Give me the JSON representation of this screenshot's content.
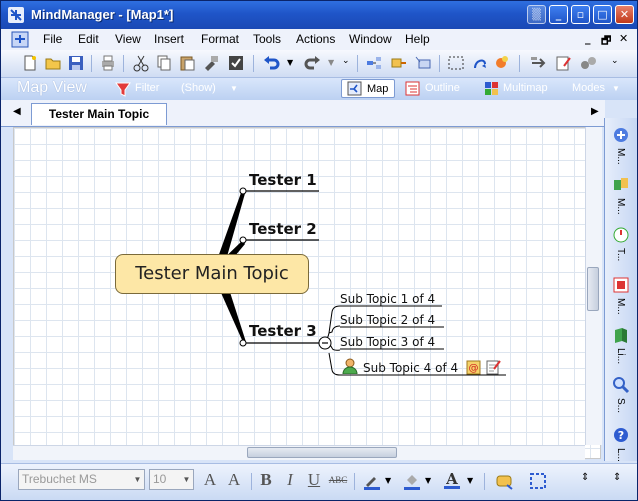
{
  "window": {
    "title": "MindManager - [Map1*]"
  },
  "menu": {
    "items": [
      "File",
      "Edit",
      "View",
      "Insert",
      "Format",
      "Tools",
      "Actions",
      "Window",
      "Help"
    ]
  },
  "viewbar": {
    "title": "Map View",
    "filter_label": "Filter",
    "show_label": "(Show)",
    "map_label": "Map",
    "outline_label": "Outline",
    "multimap_label": "Multimap",
    "modes_label": "Modes"
  },
  "tabs": [
    {
      "label": "Tester Main Topic"
    }
  ],
  "map": {
    "central": "Tester Main Topic",
    "topics": [
      {
        "label": "Tester 1"
      },
      {
        "label": "Tester 2"
      },
      {
        "label": "Tester 3",
        "subtopics": [
          "Sub Topic 1 of 4",
          "Sub Topic 2 of 4",
          "Sub Topic 3 of 4",
          "Sub Topic 4 of 4"
        ]
      }
    ]
  },
  "sidebar": {
    "items": [
      "M...",
      "M...",
      "T...",
      "M...",
      "Li...",
      "S...",
      "L..."
    ]
  },
  "format": {
    "font": "Trebuchet MS",
    "size": "10"
  },
  "colors": {
    "accent": "#1f55c8",
    "topic_fill": "#fde7a6",
    "branch": "#000000"
  }
}
